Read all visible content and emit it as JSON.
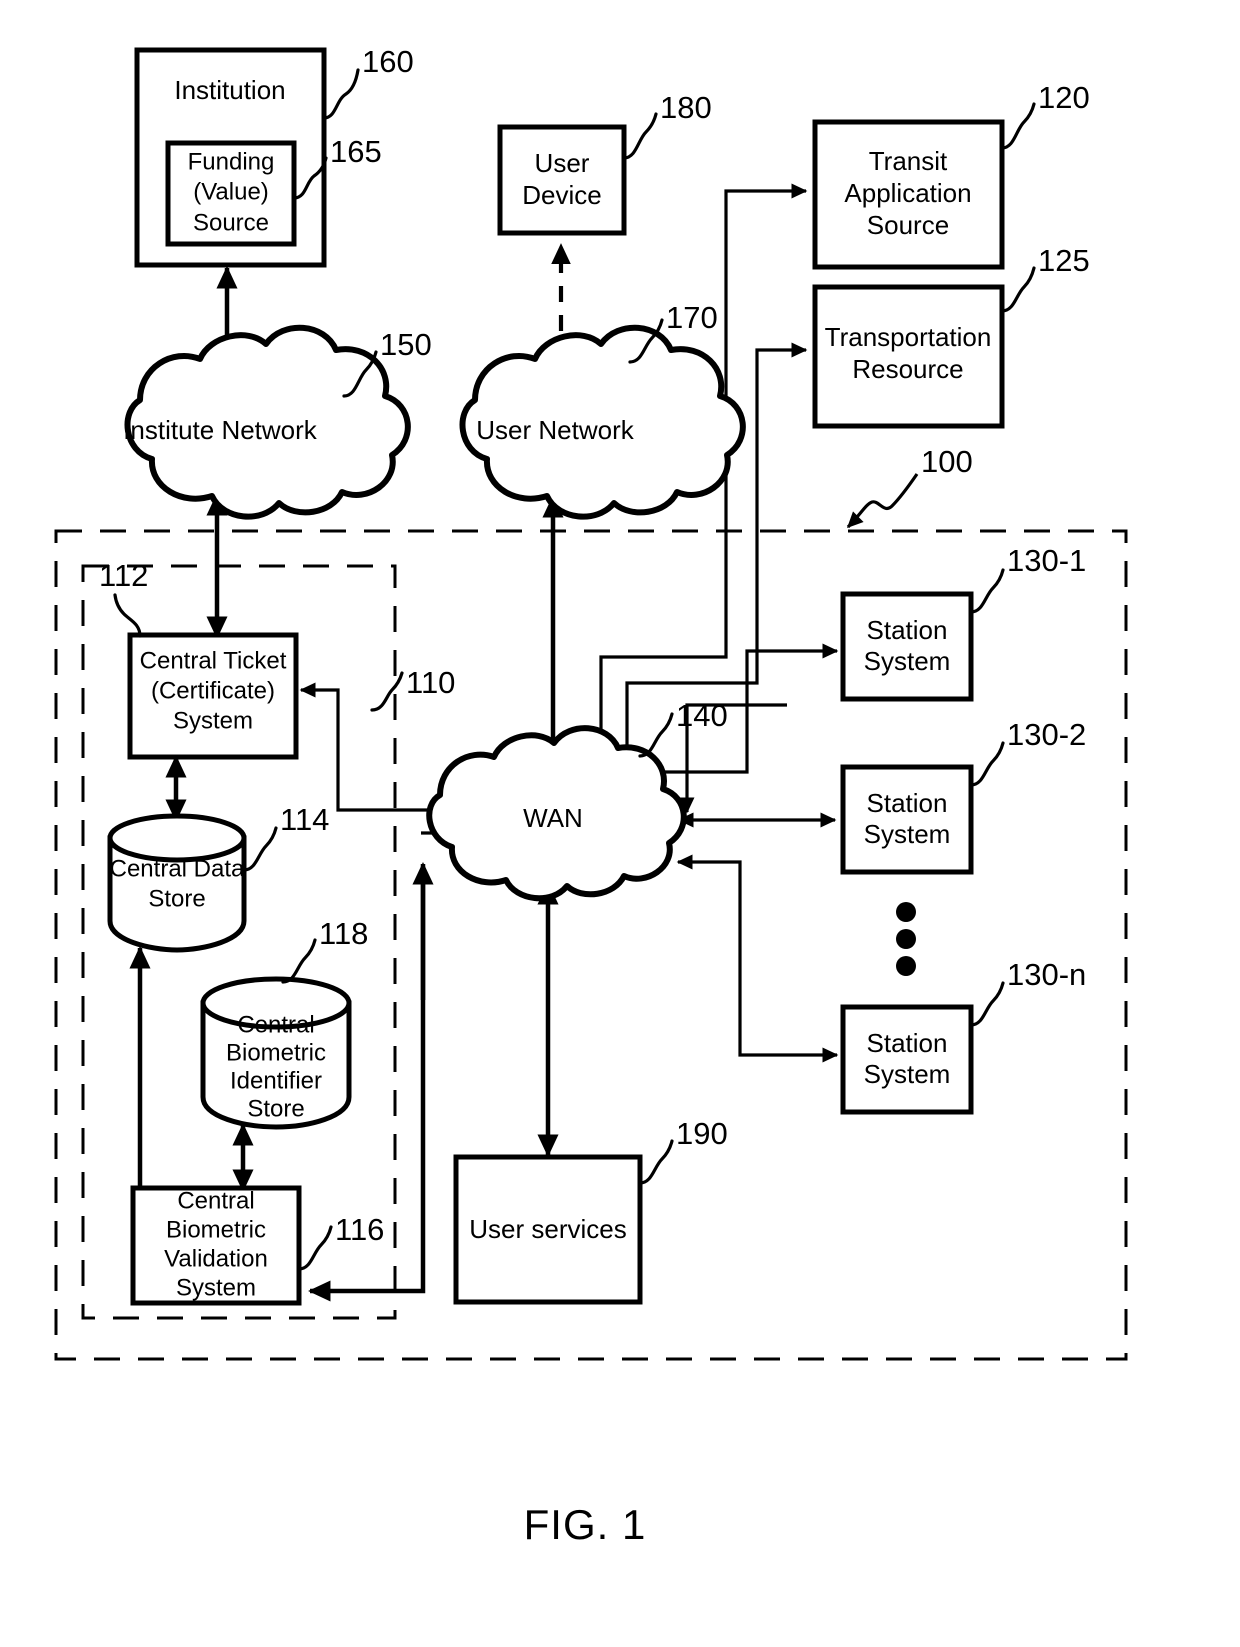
{
  "figure": {
    "caption": "FIG. 1",
    "system_ref": "100",
    "central_system_ref": "110"
  },
  "nodes": {
    "institution": {
      "label": "Institution",
      "ref": "160"
    },
    "funding_source": {
      "label_line1": "Funding",
      "label_line2": "(Value)",
      "label_line3": "Source",
      "ref": "165"
    },
    "user_device": {
      "label_line1": "User",
      "label_line2": "Device",
      "ref": "180"
    },
    "transit_application_source": {
      "label_line1": "Transit",
      "label_line2": "Application",
      "label_line3": "Source",
      "ref": "120"
    },
    "transportation_resource": {
      "label_line1": "Transportation",
      "label_line2": "Resource",
      "ref": "125"
    },
    "institute_network": {
      "label": "Institute Network",
      "ref": "150"
    },
    "user_network": {
      "label": "User Network",
      "ref": "170"
    },
    "wan": {
      "label": "WAN",
      "ref": "140"
    },
    "central_ticket_system": {
      "label_line1": "Central Ticket",
      "label_line2": "(Certificate)",
      "label_line3": "System",
      "ref": "112"
    },
    "central_data_store": {
      "label_line1": "Central Data",
      "label_line2": "Store",
      "ref": "114"
    },
    "central_biometric_identifier_store": {
      "label_line1": "Central",
      "label_line2": "Biometric",
      "label_line3": "Identifier",
      "label_line4": "Store",
      "ref": "118"
    },
    "central_biometric_validation_system": {
      "label_line1": "Central",
      "label_line2": "Biometric",
      "label_line3": "Validation",
      "label_line4": "System",
      "ref": "116"
    },
    "user_services": {
      "label": "User services",
      "ref": "190"
    },
    "station_system_1": {
      "label_line1": "Station",
      "label_line2": "System",
      "ref": "130-1"
    },
    "station_system_2": {
      "label_line1": "Station",
      "label_line2": "System",
      "ref": "130-2"
    },
    "station_system_n": {
      "label_line1": "Station",
      "label_line2": "System",
      "ref": "130-n"
    }
  },
  "colors": {
    "stroke": "#000000",
    "background": "#ffffff"
  }
}
